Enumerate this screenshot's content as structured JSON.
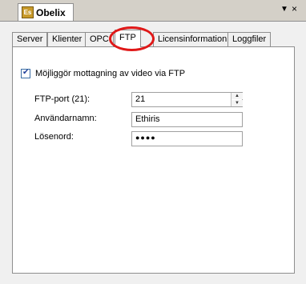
{
  "window": {
    "app_icon_text": "Es",
    "title": "Obelix",
    "dropdown_glyph": "▼",
    "close_glyph": "×"
  },
  "tabs": [
    {
      "label": "Server",
      "active": false
    },
    {
      "label": "Klienter",
      "active": false
    },
    {
      "label": "OPC",
      "active": false
    },
    {
      "label": "FTP",
      "active": true
    },
    {
      "label": "Licensinformation",
      "active": false
    },
    {
      "label": "Loggfiler",
      "active": false
    }
  ],
  "ftp": {
    "enable_checkbox_label": "Möjliggör mottagning av video via FTP",
    "enable_checked": true,
    "port_label": "FTP-port (21):",
    "port_value": "21",
    "username_label": "Användarnamn:",
    "username_value": "Ethiris",
    "password_label": "Lösenord:",
    "password_value": "●●●●"
  },
  "colors": {
    "highlight": "#e01818",
    "window_bg": "#d4d0c8",
    "panel_bg": "#ffffff"
  }
}
